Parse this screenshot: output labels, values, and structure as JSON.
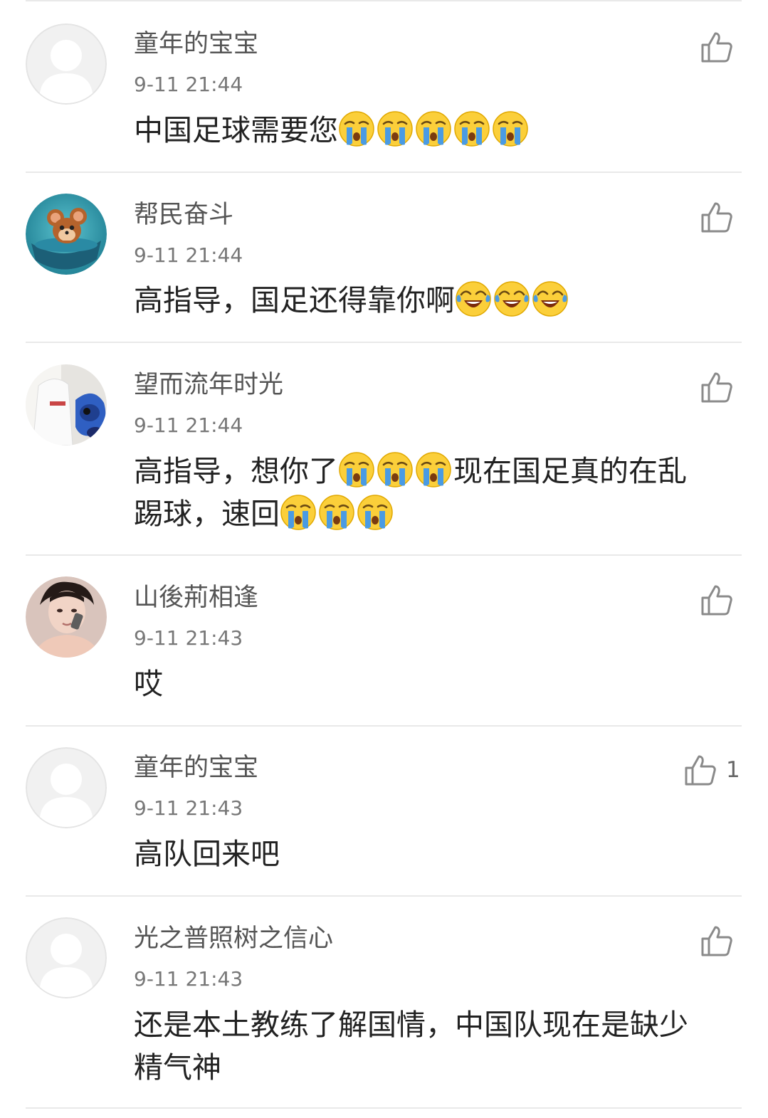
{
  "comments": [
    {
      "username": "童年的宝宝",
      "time": "9-11 21:44",
      "avatar": "default-avatar",
      "text_parts": [
        "中国足球需要您"
      ],
      "emojis": [
        "crying-emoji",
        "crying-emoji",
        "crying-emoji",
        "crying-emoji",
        "crying-emoji"
      ],
      "likes": ""
    },
    {
      "username": "帮民奋斗",
      "time": "9-11 21:44",
      "avatar": "cartoon-mouse-avatar",
      "text_parts": [
        "高指导，国足还得靠你啊"
      ],
      "emojis": [
        "laugh-cry-emoji",
        "laugh-cry-emoji",
        "laugh-cry-emoji"
      ],
      "likes": ""
    },
    {
      "username": "望而流年时光",
      "time": "9-11 21:44",
      "avatar": "photo-avatar",
      "text_parts": [
        "高指导，想你了",
        "现在国足真的在乱",
        "踢球，速回"
      ],
      "emojis": [
        "crying-emoji",
        "crying-emoji",
        "crying-emoji",
        "crying-emoji",
        "crying-emoji",
        "crying-emoji"
      ],
      "likes": ""
    },
    {
      "username": "山後荊相逢",
      "time": "9-11 21:43",
      "avatar": "portrait-avatar",
      "text_parts": [
        "哎"
      ],
      "emojis": [],
      "likes": ""
    },
    {
      "username": "童年的宝宝",
      "time": "9-11 21:43",
      "avatar": "default-avatar",
      "text_parts": [
        "高队回来吧"
      ],
      "emojis": [],
      "likes": "1"
    },
    {
      "username": "光之普照树之信心",
      "time": "9-11 21:43",
      "avatar": "default-avatar",
      "text_parts": [
        "还是本土教练了解国情，中国队现在是缺少",
        "精气神"
      ],
      "emojis": [],
      "likes": ""
    }
  ],
  "icons": {
    "like": "thumbs-up-icon",
    "crying": "crying-emoji",
    "laugh_cry": "laugh-cry-emoji"
  },
  "colors": {
    "username": "#555555",
    "timestamp": "#777777",
    "text": "#222222",
    "divider": "#e9e9e9",
    "icon": "#8a8a8a"
  }
}
